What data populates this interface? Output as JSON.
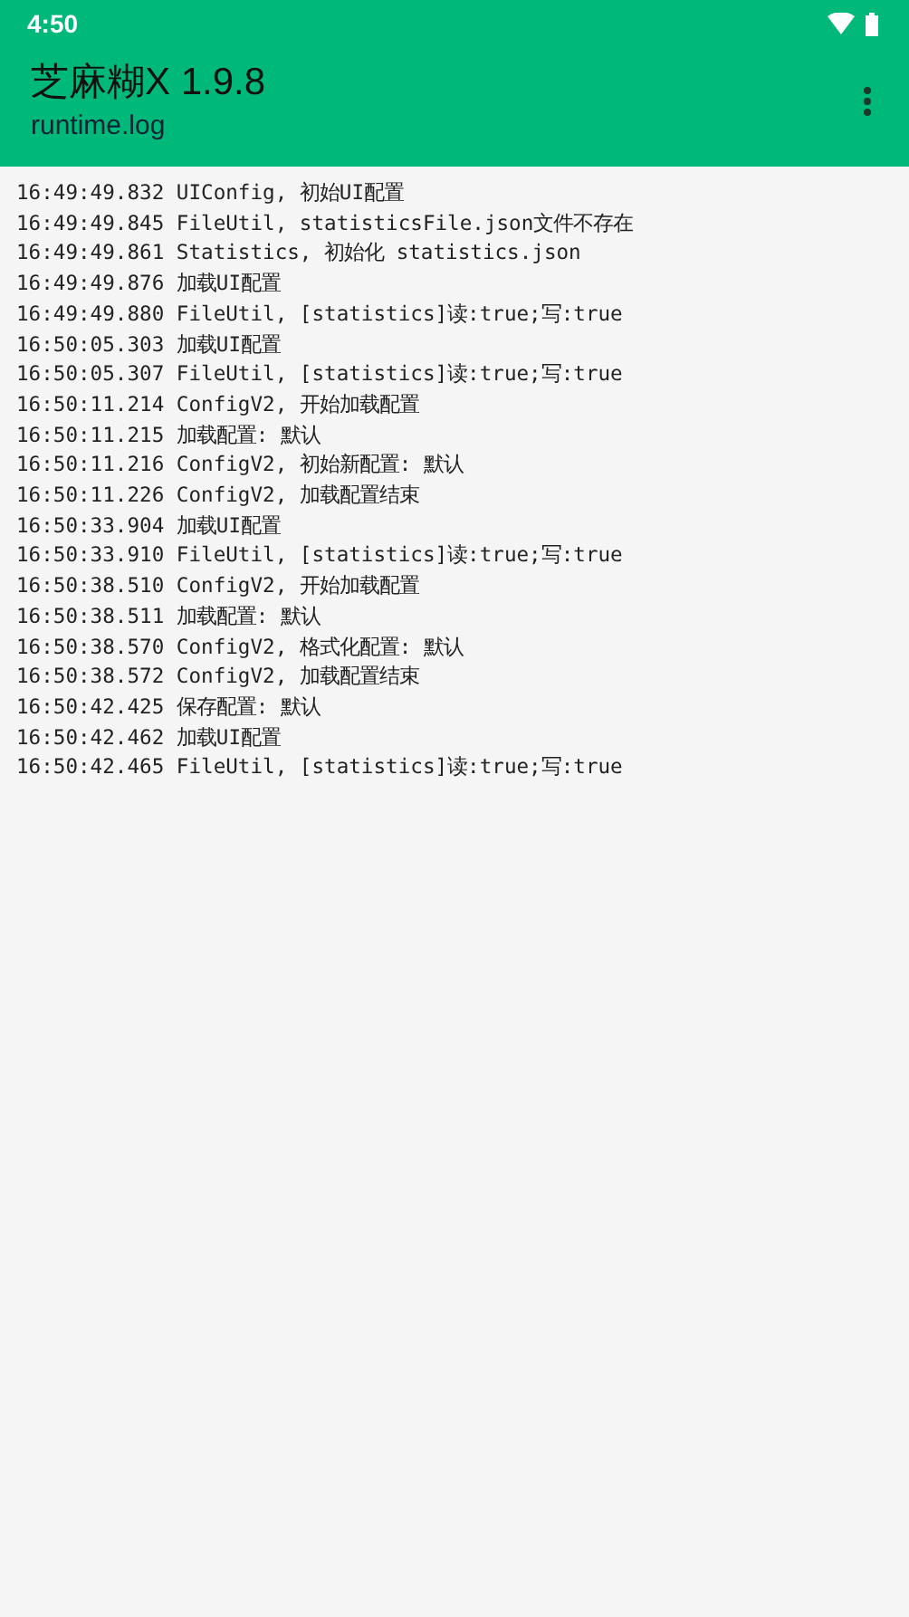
{
  "status_bar": {
    "time": "4:50"
  },
  "app_bar": {
    "title": "芝麻糊X 1.9.8",
    "subtitle": "runtime.log"
  },
  "log_lines": [
    "16:49:49.832 UIConfig, 初始UI配置",
    "16:49:49.845 FileUtil, statisticsFile.json文件不存在",
    "16:49:49.861 Statistics, 初始化 statistics.json",
    "16:49:49.876 加载UI配置",
    "16:49:49.880 FileUtil, [statistics]读:true;写:true",
    "16:50:05.303 加载UI配置",
    "16:50:05.307 FileUtil, [statistics]读:true;写:true",
    "16:50:11.214 ConfigV2, 开始加载配置",
    "16:50:11.215 加载配置: 默认",
    "16:50:11.216 ConfigV2, 初始新配置: 默认",
    "16:50:11.226 ConfigV2, 加载配置结束",
    "16:50:33.904 加载UI配置",
    "16:50:33.910 FileUtil, [statistics]读:true;写:true",
    "16:50:38.510 ConfigV2, 开始加载配置",
    "16:50:38.511 加载配置: 默认",
    "16:50:38.570 ConfigV2, 格式化配置: 默认",
    "16:50:38.572 ConfigV2, 加载配置结束",
    "16:50:42.425 保存配置: 默认",
    "16:50:42.462 加载UI配置",
    "16:50:42.465 FileUtil, [statistics]读:true;写:true"
  ]
}
